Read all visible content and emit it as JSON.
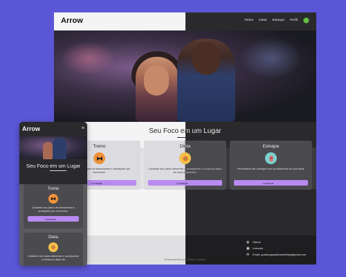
{
  "brand": {
    "name": "Arrow"
  },
  "nav": {
    "items": [
      "Treino",
      "Dieta",
      "Estoque",
      "Perfil"
    ]
  },
  "hero": {
    "title": "Seu Foco em um Lugar"
  },
  "cards": [
    {
      "title": "Treino",
      "icon": "dumbbell-icon",
      "icon_color": "#f0913a",
      "description": "Cadastre seu plano de treinamento e anotações por exercícios.",
      "button": "Começar"
    },
    {
      "title": "Dieta",
      "icon": "food-icon",
      "icon_color": "#f2c04a",
      "description": "Cadastre seu plano alimentar e acompanhe o consumo diário de macronutrientes.",
      "button": "Começar"
    },
    {
      "title": "Estoque",
      "icon": "fridge-icon",
      "icon_color": "#7ad3d0",
      "description": "Personalize seu estoque com os alimentos de sua dieta.",
      "button": "Começar"
    }
  ],
  "mobile_cards": [
    {
      "title": "Treino",
      "description": "Cadastre seu plano de treinamento e anotações por exercícios.",
      "button": "Começar"
    },
    {
      "title": "Dieta",
      "description": "Cadastre seu plano alimentar e acompanhe o consumo diário de"
    }
  ],
  "footer": {
    "credit": "Desenvolvido por Gustavo Saldiva",
    "social": [
      "Github",
      "LinkedIn",
      "Email: gustavogsaldivamathias@gmail.com"
    ]
  },
  "colors": {
    "accent": "#b98af0",
    "background": "#5b56d6",
    "avatar": "#6cc04a"
  }
}
